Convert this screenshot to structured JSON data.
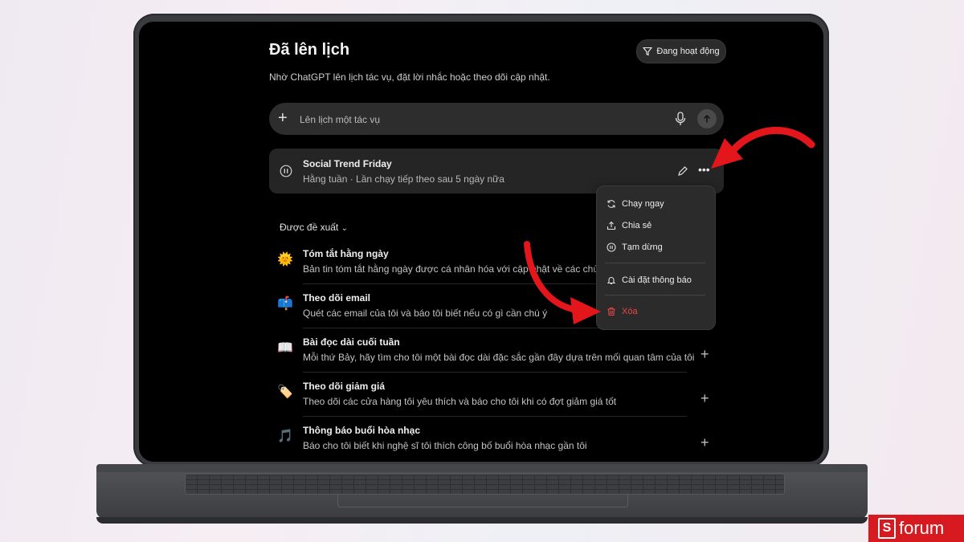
{
  "page": {
    "title": "Đã lên lịch",
    "subtitle": "Nhờ ChatGPT lên lịch tác vụ, đặt lời nhắc hoặc theo dõi cập nhật.",
    "filter_label": "Đang hoạt động"
  },
  "composer": {
    "placeholder": "Lên lịch một tác vụ"
  },
  "task": {
    "title": "Social Trend Friday",
    "meta": "Hằng tuần · Lần chạy tiếp theo sau 5 ngày nữa"
  },
  "suggested": {
    "heading": "Được đề xuất",
    "items": [
      {
        "icon": "sun-emoji",
        "emoji": "🌞",
        "title": "Tóm tắt hằng ngày",
        "desc": "Bản tin tóm tắt hằng ngày được cá nhân hóa với cập nhật về các chủ đề"
      },
      {
        "icon": "mailbox-emoji",
        "emoji": "📫",
        "title": "Theo dõi email",
        "desc": "Quét các email của tôi và báo tôi biết nếu có gì cần chú ý"
      },
      {
        "icon": "book-emoji",
        "emoji": "📖",
        "title": "Bài đọc dài cuối tuần",
        "desc": "Mỗi thứ Bảy, hãy tìm cho tôi một bài đọc dài đặc sắc gần đây dựa trên mối quan tâm của tôi"
      },
      {
        "icon": "tag-emoji",
        "emoji": "🏷️",
        "title": "Theo dõi giảm giá",
        "desc": "Theo dõi các cửa hàng tôi yêu thích và báo cho tôi khi có đợt giảm giá tốt"
      },
      {
        "icon": "music-emoji",
        "emoji": "🎵",
        "title": "Thông báo buổi hòa nhạc",
        "desc": "Báo cho tôi biết khi nghệ sĩ tôi thích công bố buổi hòa nhạc gần tôi"
      }
    ]
  },
  "menu": {
    "run_now": "Chạy ngay",
    "share": "Chia sẻ",
    "pause": "Tạm dừng",
    "notifications": "Cài đặt thông báo",
    "delete": "Xóa"
  },
  "watermark": {
    "text": "forum",
    "letter": "S"
  },
  "colors": {
    "accent_red": "#d71920",
    "danger": "#ef4444",
    "screen_bg": "#000000"
  }
}
